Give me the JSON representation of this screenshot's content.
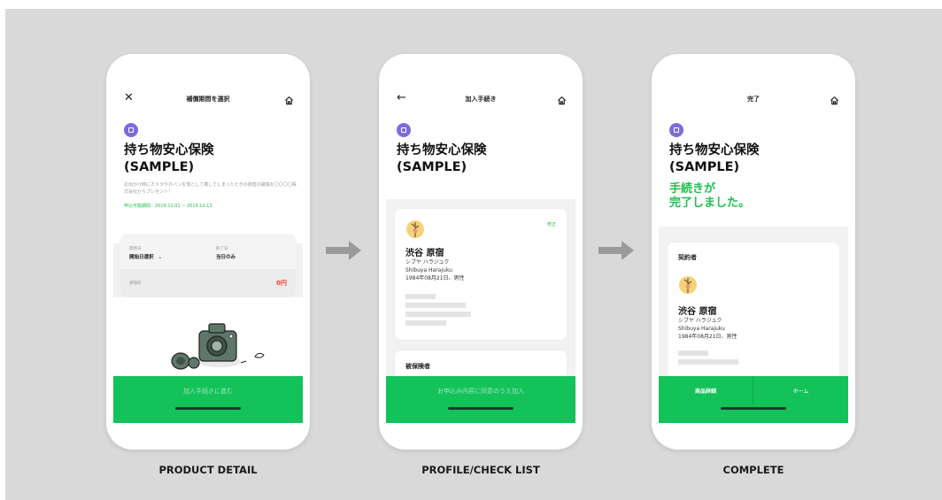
{
  "colors": {
    "accent_green": "#14c25a",
    "cta_label_green": "#9fe4b9",
    "product_icon_purple": "#7b6be0",
    "price_red": "#ff3b30",
    "canvas_gray": "#d9d9d9"
  },
  "icons": [
    "close-icon",
    "back-arrow-icon",
    "home-icon",
    "product-box-icon",
    "chevron-down-icon",
    "avatar-illustration",
    "camera-illustration",
    "flow-arrow-icon"
  ],
  "screen1": {
    "nav_title": "補償期間を選択",
    "product_name_line1": "持ち物安心保険",
    "product_name_line2": "(SAMPLE)",
    "description": "お出かけ時にカメラやカバンを落として壊してしまったときの損害の補償を〇〇〇〇株式会社からプレゼント！",
    "period": "申込可能期間：2019.11.01 ~ 2019.12.13",
    "start_label": "開始日",
    "start_value": "開始日選択",
    "end_label": "終了日",
    "end_value": "当日のみ",
    "premium_label": "保険料",
    "premium_value": "0円",
    "cta_label": "加入手続きに進む"
  },
  "screen2": {
    "nav_title": "加入手続き",
    "product_name_line1": "持ち物安心保険",
    "product_name_line2": "(SAMPLE)",
    "edit_label": "修正",
    "name": "渋谷 原宿",
    "kana": "シブヤ ハラジュク",
    "roman": "Shibuya Harajuku",
    "birth_gender": "1984年08月21日、男性",
    "insured_section": "被保険者",
    "cta_label": "お申込み内容に同意のうえ加入"
  },
  "screen3": {
    "nav_title": "完了",
    "product_name_line1": "持ち物安心保険",
    "product_name_line2": "(SAMPLE)",
    "complete_line1": "手続きが",
    "complete_line2": "完了しました。",
    "contractor_section": "契約者",
    "name": "渋谷 原宿",
    "kana": "シブヤ ハラジュク",
    "roman": "Shibuya Harajuku",
    "birth_gender": "1984年08月21日、男性",
    "product_detail_button": "商品詳細",
    "home_button": "ホーム"
  },
  "captions": {
    "screen1": "PRODUCT DETAIL",
    "screen2": "PROFILE/CHECK LIST",
    "screen3": "COMPLETE"
  }
}
